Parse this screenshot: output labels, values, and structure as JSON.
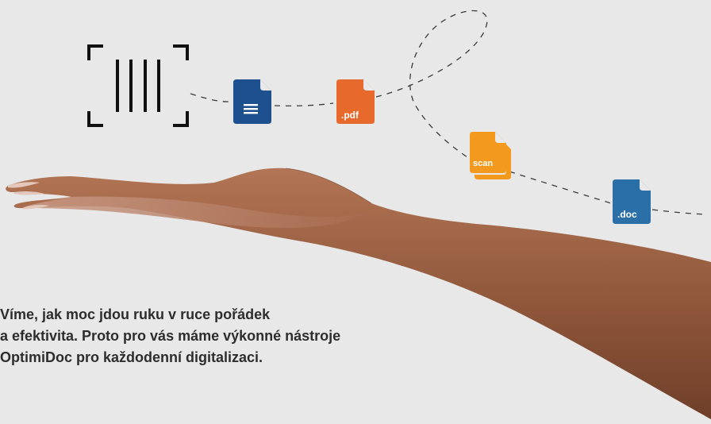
{
  "icons": {
    "barcode": "barcode-scanner-icon",
    "blue_doc": "text-document-icon",
    "pdf": "pdf-file-icon",
    "scan": "scan-file-icon",
    "doc": "doc-file-icon"
  },
  "file_labels": {
    "pdf": ".pdf",
    "scan": "scan",
    "doc": ".doc"
  },
  "colors": {
    "background": "#e8e8e8",
    "dark_blue": "#1e4f8f",
    "orange": "#e8692c",
    "amber": "#f39a1e",
    "doc_blue": "#2a6fa8",
    "text": "#2d2d2d",
    "skin": "#9a6044"
  },
  "headline": {
    "line1": "Víme, jak moc jdou ruku v ruce pořádek",
    "line2": "a efektivita. Proto pro vás máme výkonné nástroje",
    "line3": "OptimiDoc pro každodenní digitalizaci."
  }
}
